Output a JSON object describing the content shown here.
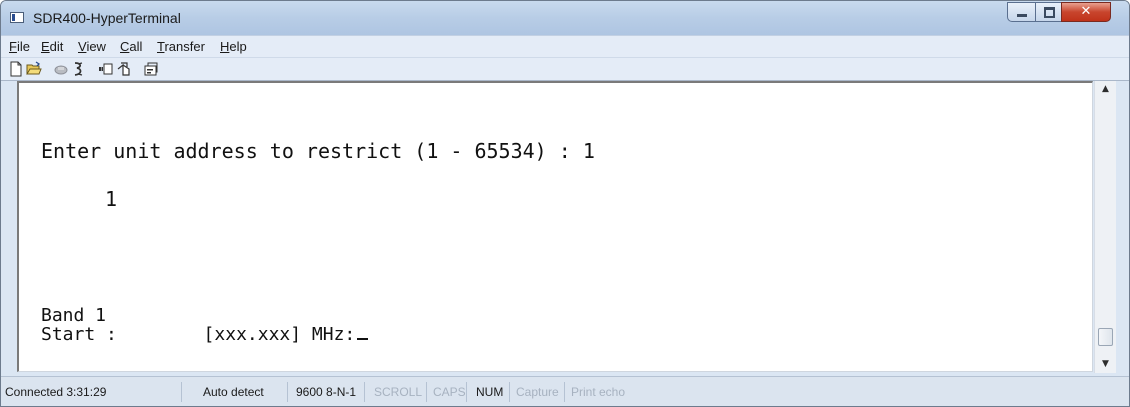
{
  "window": {
    "title": "SDR400-HyperTerminal"
  },
  "menu": {
    "file": {
      "first": "F",
      "rest": "ile"
    },
    "edit": {
      "first": "E",
      "rest": "dit"
    },
    "view": {
      "first": "V",
      "rest": "iew"
    },
    "call": {
      "first": "C",
      "rest": "all"
    },
    "transfer": {
      "first": "T",
      "rest": "ransfer"
    },
    "help": {
      "first": "H",
      "rest": "elp"
    }
  },
  "toolbar": {
    "icons": [
      "new-icon",
      "open-icon",
      "disconnect-icon",
      "dial-icon",
      "send-icon",
      "receive-icon",
      "properties-icon"
    ]
  },
  "terminal": {
    "line1": "Enter unit address to restrict (1 - 65534) : 1",
    "line2": "1",
    "line3": "Band 1",
    "line4": "Start :        [xxx.xxx] MHz:"
  },
  "status": {
    "connected": "Connected 3:31:29",
    "detect": "Auto detect",
    "settings": "9600 8-N-1",
    "scroll": "SCROLL",
    "caps": "CAPS",
    "num": "NUM",
    "capture": "Capture",
    "print_echo": "Print echo"
  },
  "colors": {
    "title_bar": "#b8cde6",
    "close_button": "#c8452d",
    "terminal_bg": "#ffffff",
    "terminal_text": "#111111",
    "inactive_status": "#a7b2c0"
  }
}
